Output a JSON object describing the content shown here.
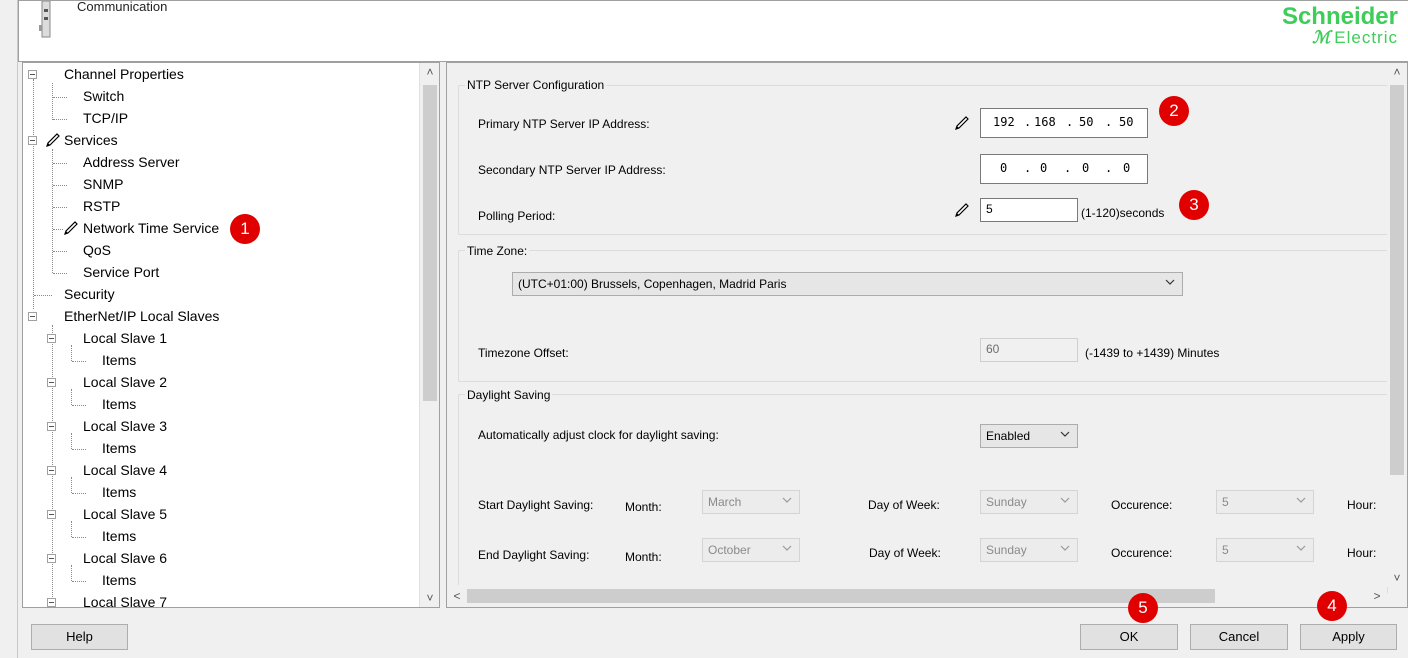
{
  "header": {
    "title": "Communication",
    "brand_line1": "Schneider",
    "brand_line2": "Electric"
  },
  "tree": {
    "items": [
      {
        "label": "Channel Properties"
      },
      {
        "label": "Switch"
      },
      {
        "label": "TCP/IP"
      },
      {
        "label": "Services"
      },
      {
        "label": "Address Server"
      },
      {
        "label": "SNMP"
      },
      {
        "label": "RSTP"
      },
      {
        "label": "Network Time Service"
      },
      {
        "label": "QoS"
      },
      {
        "label": "Service Port"
      },
      {
        "label": "Security"
      },
      {
        "label": "EtherNet/IP Local Slaves"
      },
      {
        "label": "Local Slave 1"
      },
      {
        "label": "Items"
      },
      {
        "label": "Local Slave 2"
      },
      {
        "label": "Items"
      },
      {
        "label": "Local Slave 3"
      },
      {
        "label": "Items"
      },
      {
        "label": "Local Slave 4"
      },
      {
        "label": "Items"
      },
      {
        "label": "Local Slave 5"
      },
      {
        "label": "Items"
      },
      {
        "label": "Local Slave 6"
      },
      {
        "label": "Items"
      },
      {
        "label": "Local Slave 7"
      }
    ]
  },
  "badges": {
    "b1": "1",
    "b2": "2",
    "b3": "3",
    "b4": "4",
    "b5": "5"
  },
  "ntp": {
    "group_label": "NTP Server Configuration",
    "primary_label": "Primary NTP Server IP Address:",
    "primary_octets": [
      "192",
      "168",
      "50",
      "50"
    ],
    "secondary_label": "Secondary NTP Server IP Address:",
    "secondary_octets": [
      "0",
      "0",
      "0",
      "0"
    ],
    "polling_label": "Polling Period:",
    "polling_value": "5",
    "polling_hint": "(1-120)seconds"
  },
  "timezone": {
    "group_label": "Time Zone:",
    "selected": "(UTC+01:00) Brussels, Copenhagen, Madrid Paris",
    "offset_label": "Timezone Offset:",
    "offset_value": "60",
    "offset_hint": "(-1439 to +1439) Minutes"
  },
  "daylight": {
    "group_label": "Daylight Saving",
    "auto_label": "Automatically adjust clock for daylight saving:",
    "auto_value": "Enabled",
    "start_label": "Start Daylight Saving:",
    "end_label": "End Daylight Saving:",
    "month_label": "Month:",
    "dow_label": "Day of Week:",
    "occ_label": "Occurence:",
    "hour_label": "Hour:",
    "start_month": "March",
    "start_dow": "Sunday",
    "start_occ": "5",
    "end_month": "October",
    "end_dow": "Sunday",
    "end_occ": "5"
  },
  "buttons": {
    "help": "Help",
    "ok": "OK",
    "cancel": "Cancel",
    "apply": "Apply"
  },
  "colors": {
    "badge": "#e00000",
    "brand": "#3dcd58"
  }
}
